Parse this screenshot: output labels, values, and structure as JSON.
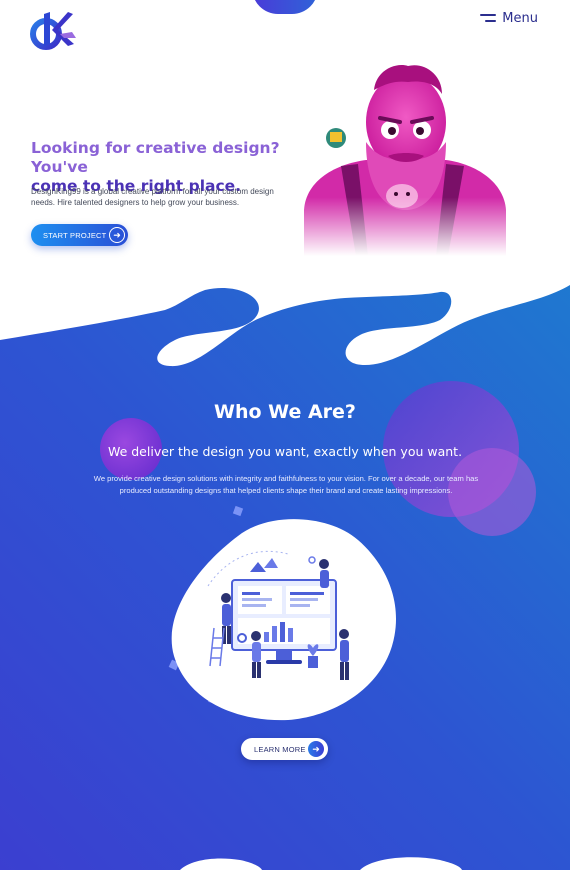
{
  "header": {
    "logo_text": "DK",
    "menu_label": "Menu"
  },
  "hero": {
    "title_line1": "Looking for creative design? You've",
    "title_line2": "come to the right place.",
    "description": "DesignKing99 is a global creative platform for all your custom design needs. Hire talented designers to help grow your business.",
    "cta_label": "START PROJECT",
    "cta_icon": "arrow-right-icon",
    "illustration": "bearded-king-mascot"
  },
  "about": {
    "title": "Who We Are?",
    "subtitle": "We deliver the design you want, exactly when you want.",
    "description": "We provide creative design solutions with integrity and faithfulness to your vision. For over a decade, our team has produced outstanding designs that helped clients shape their brand and create lasting impressions.",
    "illustration": "team-dashboard-illustration",
    "cta_label": "LEARN MORE",
    "cta_icon": "arrow-right-icon"
  },
  "colors": {
    "primary_blue": "#2a4fd6",
    "accent_purple": "#7b3fd6",
    "hero_title_light": "#8a62d6",
    "hero_title_dark": "#4b32b5",
    "mascot_pink": "#e020a8"
  }
}
